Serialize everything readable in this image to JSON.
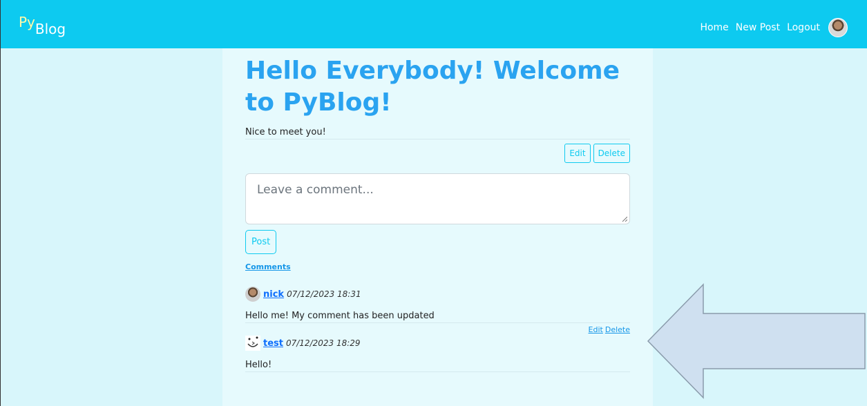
{
  "navbar": {
    "brand_py": "Py",
    "brand_blog": "Blog",
    "links": [
      "Home",
      "New Post",
      "Logout"
    ]
  },
  "post": {
    "title": "Hello Everybody! Welcome to PyBlog!",
    "body": "Nice to meet you!",
    "edit_label": "Edit",
    "delete_label": "Delete"
  },
  "comment_form": {
    "placeholder": "Leave a comment...",
    "submit_label": "Post"
  },
  "comments_heading": "Comments",
  "comments": [
    {
      "user": "nick",
      "date": "07/12/2023 18:31",
      "body": "Hello me! My comment has been updated",
      "edit_label": "Edit",
      "delete_label": "Delete"
    },
    {
      "user": "test",
      "date": "07/12/2023 18:29",
      "body": "Hello!"
    }
  ],
  "colors": {
    "navbar": "#0dcaf0",
    "title": "#2aa3f0",
    "background": "#d8f6fb",
    "arrow_fill": "#cfe0f0"
  }
}
